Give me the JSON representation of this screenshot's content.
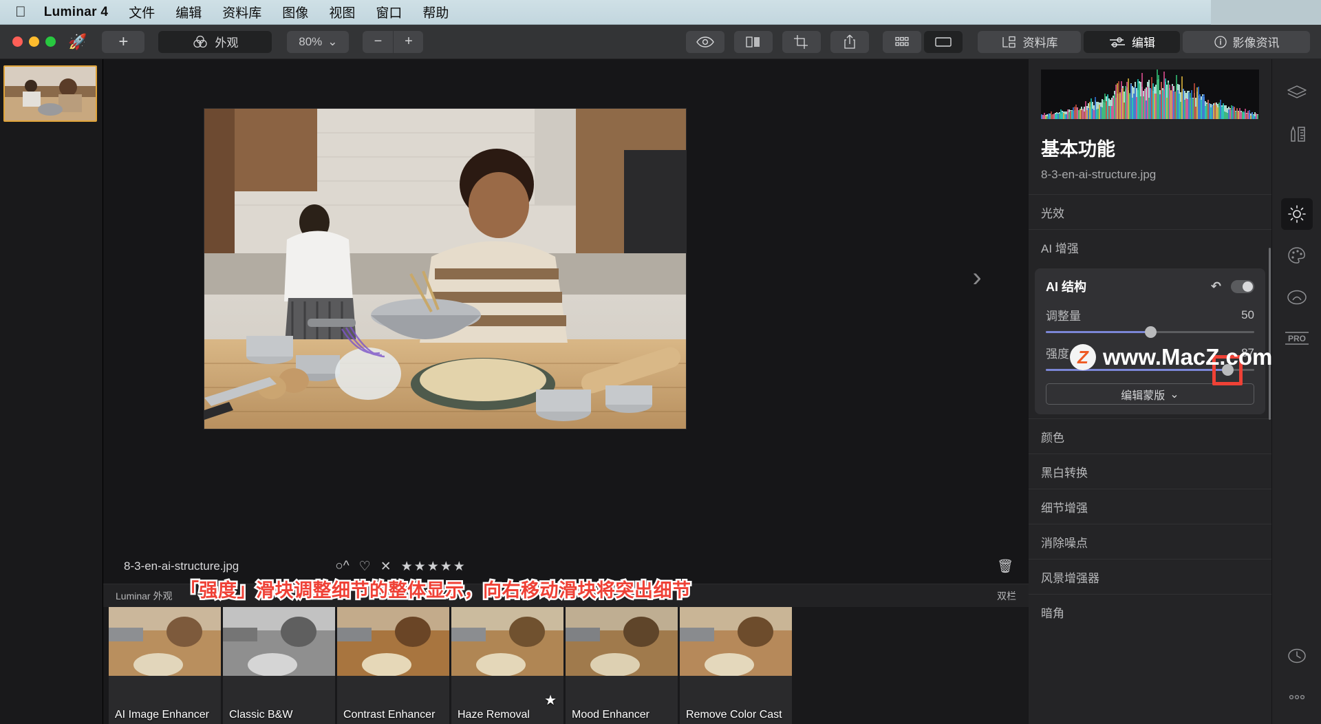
{
  "menubar": {
    "apple_icon": "apple-logo",
    "app_name": "Luminar 4",
    "items": [
      "文件",
      "编辑",
      "资料库",
      "图像",
      "视图",
      "窗口",
      "帮助"
    ]
  },
  "toolbar": {
    "add_label": "+",
    "looks_label": "外观",
    "looks_icon": "venn-circles-icon",
    "zoom_value": "80%",
    "zoom_caret": "⌄",
    "minus_label": "−",
    "plus_label": "+",
    "icons": [
      "eye-icon",
      "before-after-icon",
      "crop-icon",
      "share-icon",
      "grid-icon",
      "single-view-icon"
    ],
    "tabs": [
      {
        "label": "资料库",
        "icon": "library-icon",
        "active": false
      },
      {
        "label": "编辑",
        "icon": "sliders-icon",
        "active": true
      },
      {
        "label": "影像资讯",
        "icon": "info-icon",
        "active": false
      }
    ]
  },
  "canvas": {
    "next_arrow": "›",
    "file_name": "8-3-en-ai-structure.jpg",
    "rating": {
      "color_label_icon": "○^",
      "heart_icon": "♡",
      "reject_icon": "✕",
      "stars": "★★★★★"
    },
    "trash_icon": "trash-icon"
  },
  "annotation": {
    "text": "「强度」滑块调整细节的整体显示，向右移动滑块将突出细节",
    "color": "#ef4136"
  },
  "looks": {
    "header_label": "Luminar 外观",
    "header_right": "双栏",
    "items": [
      {
        "label": "AI Image Enhancer",
        "favorite": false
      },
      {
        "label": "Classic B&W",
        "favorite": false
      },
      {
        "label": "Contrast Enhancer",
        "favorite": false
      },
      {
        "label": "Haze Removal",
        "favorite": true
      },
      {
        "label": "Mood Enhancer",
        "favorite": false
      },
      {
        "label": "Remove Color Cast",
        "favorite": false
      }
    ]
  },
  "right_panel": {
    "title": "基本功能",
    "file_name": "8-3-en-ai-structure.jpg",
    "rows_before": [
      "光效",
      "AI 增强"
    ],
    "ai_structure": {
      "title": "AI 结构",
      "undo_icon": "undo-icon",
      "toggle_icon": "toggle-on",
      "sliders": [
        {
          "label": "调整量",
          "value": "50",
          "percent": 50
        },
        {
          "label": "强度",
          "value": "87",
          "percent": 87
        }
      ],
      "mask_button": "编辑蒙版",
      "mask_caret": "⌄"
    },
    "rows_after": [
      "颜色",
      "黑白转换",
      "细节增强",
      "消除噪点",
      "风景增强器",
      "暗角"
    ]
  },
  "rail": {
    "items": [
      {
        "icon": "layers-icon",
        "active": false
      },
      {
        "icon": "tools-icon",
        "active": false
      },
      {
        "icon": "essentials-sun-icon",
        "active": true
      },
      {
        "icon": "creative-palette-icon",
        "active": false
      },
      {
        "icon": "portrait-icon",
        "active": false
      },
      {
        "icon": "pro-icon",
        "label": "PRO",
        "active": false
      }
    ],
    "bottom": [
      {
        "icon": "history-clock-icon"
      },
      {
        "icon": "more-dots-icon"
      }
    ]
  },
  "watermark": {
    "badge": "Z",
    "text": "www.MacZ.com"
  },
  "colors": {
    "accent_slider": "#7b86d6",
    "highlight_box": "#ef4136",
    "selected_thumb_border": "#e0a43a"
  }
}
